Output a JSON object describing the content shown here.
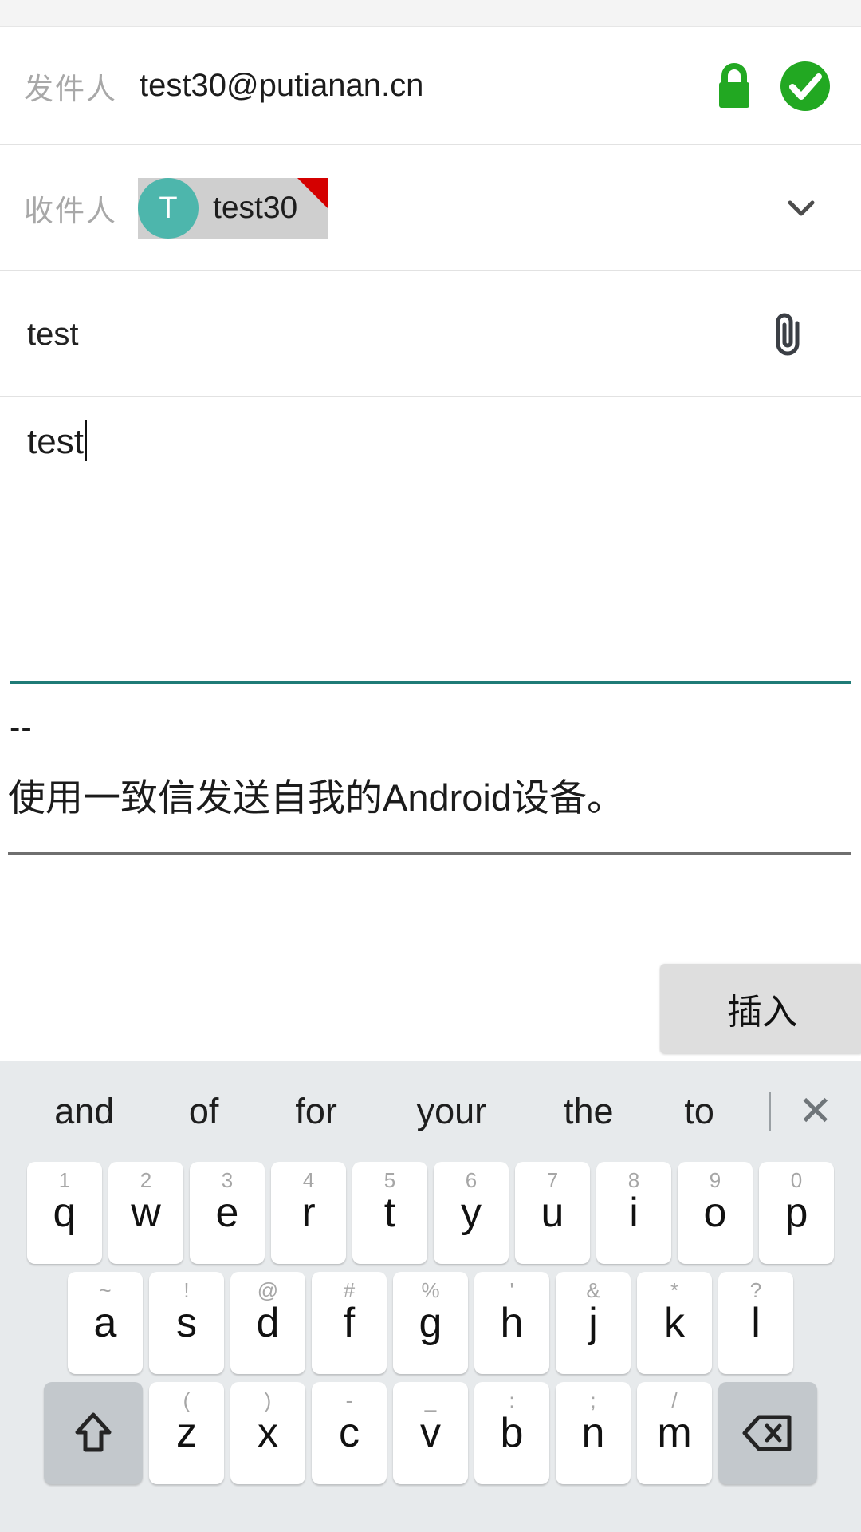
{
  "screen": {
    "app": "email-compose",
    "accent_teal": "#1f7b77",
    "chip_avatar_color": "#4db6ac",
    "chip_bg": "#cfcfcf",
    "chip_corner_color": "#d40000",
    "lock_color": "#2aaa2a",
    "check_color": "#22a822"
  },
  "compose": {
    "from": {
      "label": "发件人",
      "value": "test30@putianan.cn"
    },
    "to": {
      "label": "收件人",
      "chip": {
        "initial": "T",
        "name": "test30"
      },
      "expand_icon": "chevron-down-icon"
    },
    "subject": {
      "value": "test",
      "attach_icon": "paperclip-icon"
    },
    "body": {
      "value": "test"
    },
    "signature": {
      "separator": "--",
      "text": "使用一致信发送自我的Android设备。"
    },
    "insert_button": {
      "label": "插入"
    }
  },
  "keyboard": {
    "suggestions": [
      "and",
      "of",
      "for",
      "your",
      "the",
      "to"
    ],
    "close_label": "✕",
    "rows": [
      [
        {
          "key": "q",
          "hint": "1"
        },
        {
          "key": "w",
          "hint": "2"
        },
        {
          "key": "e",
          "hint": "3"
        },
        {
          "key": "r",
          "hint": "4"
        },
        {
          "key": "t",
          "hint": "5"
        },
        {
          "key": "y",
          "hint": "6"
        },
        {
          "key": "u",
          "hint": "7"
        },
        {
          "key": "i",
          "hint": "8"
        },
        {
          "key": "o",
          "hint": "9"
        },
        {
          "key": "p",
          "hint": "0"
        }
      ],
      [
        {
          "key": "a",
          "hint": "~"
        },
        {
          "key": "s",
          "hint": "!"
        },
        {
          "key": "d",
          "hint": "@"
        },
        {
          "key": "f",
          "hint": "#"
        },
        {
          "key": "g",
          "hint": "%"
        },
        {
          "key": "h",
          "hint": "'"
        },
        {
          "key": "j",
          "hint": "&"
        },
        {
          "key": "k",
          "hint": "*"
        },
        {
          "key": "l",
          "hint": "?"
        }
      ],
      [
        {
          "key": "z",
          "hint": "("
        },
        {
          "key": "x",
          "hint": ")"
        },
        {
          "key": "c",
          "hint": "-"
        },
        {
          "key": "v",
          "hint": "_"
        },
        {
          "key": "b",
          "hint": ":"
        },
        {
          "key": "n",
          "hint": ";"
        },
        {
          "key": "m",
          "hint": "/"
        }
      ]
    ],
    "shift_icon": "shift-arrow-icon",
    "backspace_icon": "backspace-icon"
  }
}
